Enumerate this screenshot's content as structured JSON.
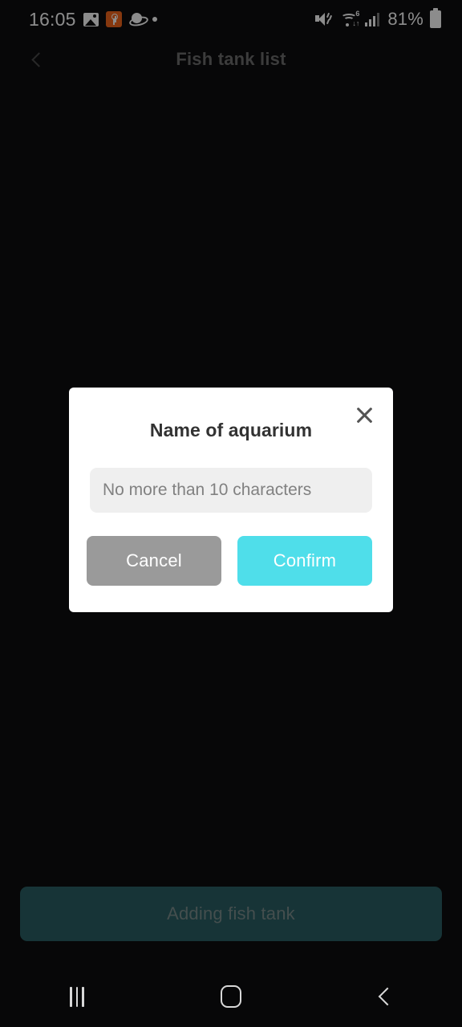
{
  "status_bar": {
    "time": "16:05",
    "battery_percent": "81%",
    "left_icons": [
      "photo-icon",
      "key-badge-icon",
      "planet-icon",
      "dot-icon"
    ],
    "right_icons": [
      "mute-icon",
      "wifi6-icon",
      "signal-bars-icon",
      "battery-icon"
    ],
    "wifi_generation": "6",
    "wifi_traffic": "↓↑"
  },
  "header": {
    "title": "Fish tank list",
    "back_icon": "chevron-left-icon"
  },
  "main": {
    "add_tank_label": "Adding fish tank"
  },
  "dialog": {
    "title": "Name of aquarium",
    "close_icon": "close-x-icon",
    "input": {
      "value": "",
      "placeholder": "No more than 10 characters"
    },
    "cancel_label": "Cancel",
    "confirm_label": "Confirm"
  },
  "nav_bar": {
    "recents_icon": "recents-icon",
    "home_icon": "home-icon",
    "back_icon": "back-chevron-icon"
  },
  "colors": {
    "background": "#0d0d0f",
    "dialog_background": "#ffffff",
    "confirm_accent": "#4fdeea",
    "cancel_gray": "#9a9a9a",
    "cta_teal": "#2a6064",
    "badge_orange": "#f4661c"
  }
}
